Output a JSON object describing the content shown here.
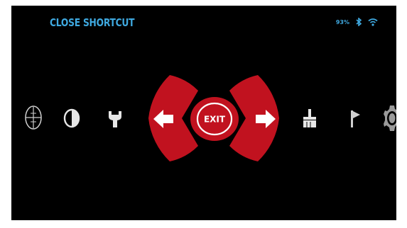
{
  "header": {
    "title": "CLOSE SHORTCUT",
    "battery": "93%"
  },
  "status_icons": [
    "bluetooth-icon",
    "wifi-icon"
  ],
  "menu": {
    "center_label": "EXIT",
    "items": [
      "reticle-icon",
      "contrast-icon",
      "wrench-icon",
      "arrow-left-icon",
      "exit-button",
      "arrow-right-icon",
      "cleaning-brush-icon",
      "flag-icon",
      "settings-gear-icon"
    ]
  },
  "colors": {
    "accent": "#3fa9e0",
    "selection": "#c1121f",
    "background": "#000000",
    "icon": "#e6e6e6"
  }
}
